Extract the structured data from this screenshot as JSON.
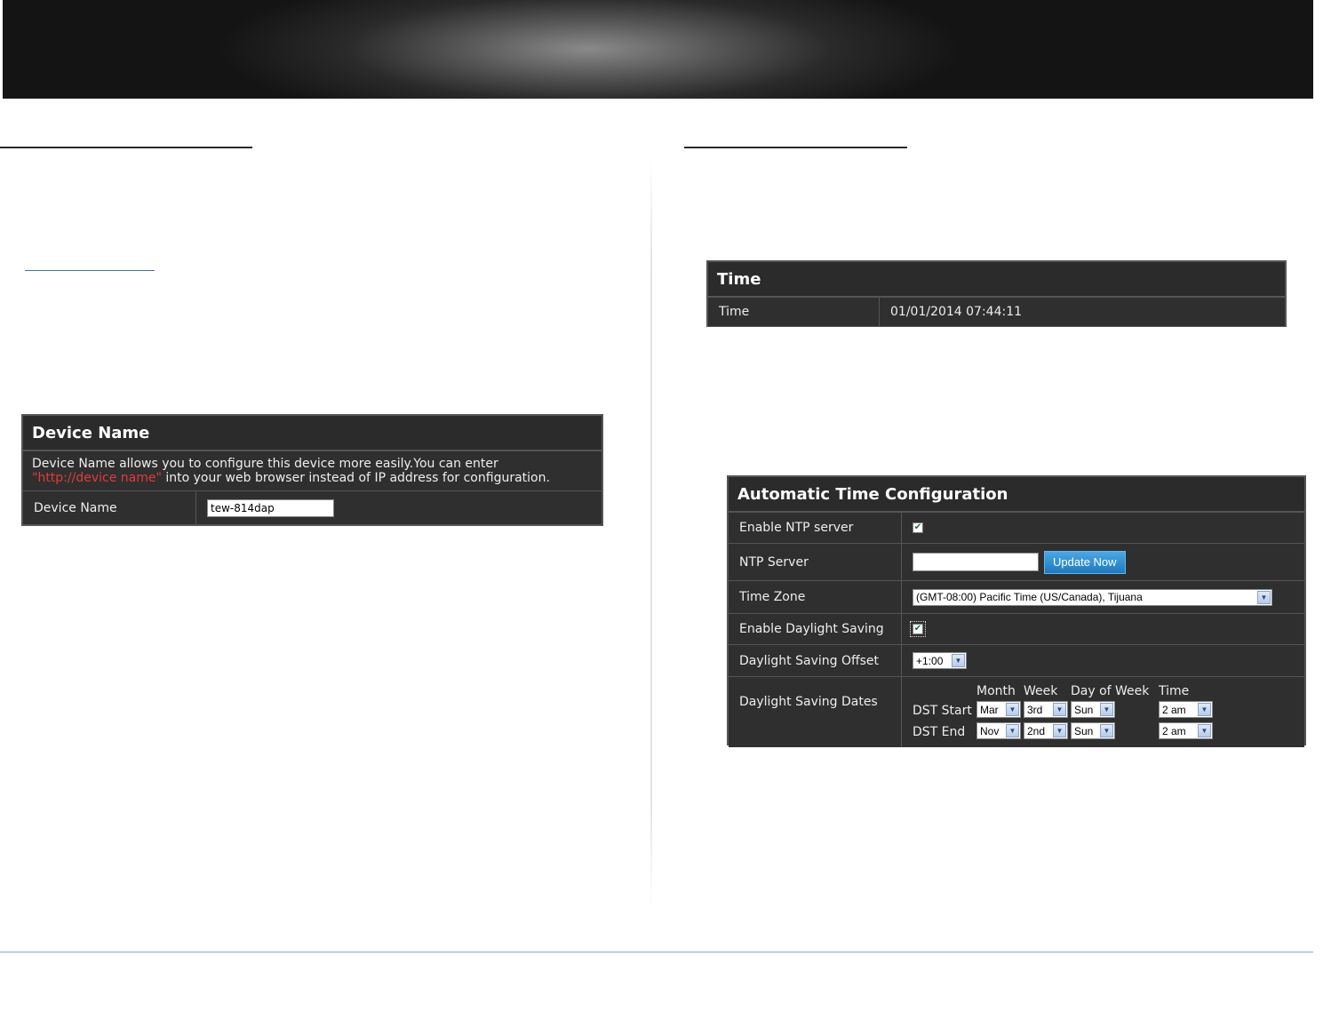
{
  "device_name_panel": {
    "title": "Device Name",
    "description_line1": "Device Name allows you to configure this device more easily.You can enter",
    "description_highlight": "\"http://device name\"",
    "description_line2": " into your web browser instead of IP address for configuration.",
    "field_label": "Device Name",
    "field_value": "tew-814dap"
  },
  "time_panel": {
    "title": "Time",
    "label": "Time",
    "value": "01/01/2014 07:44:11"
  },
  "auto_time_panel": {
    "title": "Automatic Time Configuration",
    "enable_ntp_label": "Enable NTP server",
    "enable_ntp_checked": true,
    "ntp_server_label": "NTP Server",
    "ntp_server_value": "",
    "update_button": "Update Now",
    "time_zone_label": "Time Zone",
    "time_zone_value": "(GMT-08:00) Pacific Time (US/Canada), Tijuana",
    "enable_dst_label": "Enable Daylight Saving",
    "enable_dst_checked": true,
    "dst_offset_label": "Daylight Saving Offset",
    "dst_offset_value": "+1:00",
    "dst_dates_label": "Daylight Saving Dates",
    "dst_headers": {
      "month": "Month",
      "week": "Week",
      "day_of_week": "Day of Week",
      "time": "Time"
    },
    "dst_start": {
      "label": "DST Start",
      "month": "Mar",
      "week": "3rd",
      "day": "Sun",
      "time": "2 am"
    },
    "dst_end": {
      "label": "DST End",
      "month": "Nov",
      "week": "2nd",
      "day": "Sun",
      "time": "2 am"
    }
  },
  "colors": {
    "panel_bg": "#2f2f2f",
    "highlight_red": "#e23b3b",
    "button_blue": "#2a8bd0"
  }
}
